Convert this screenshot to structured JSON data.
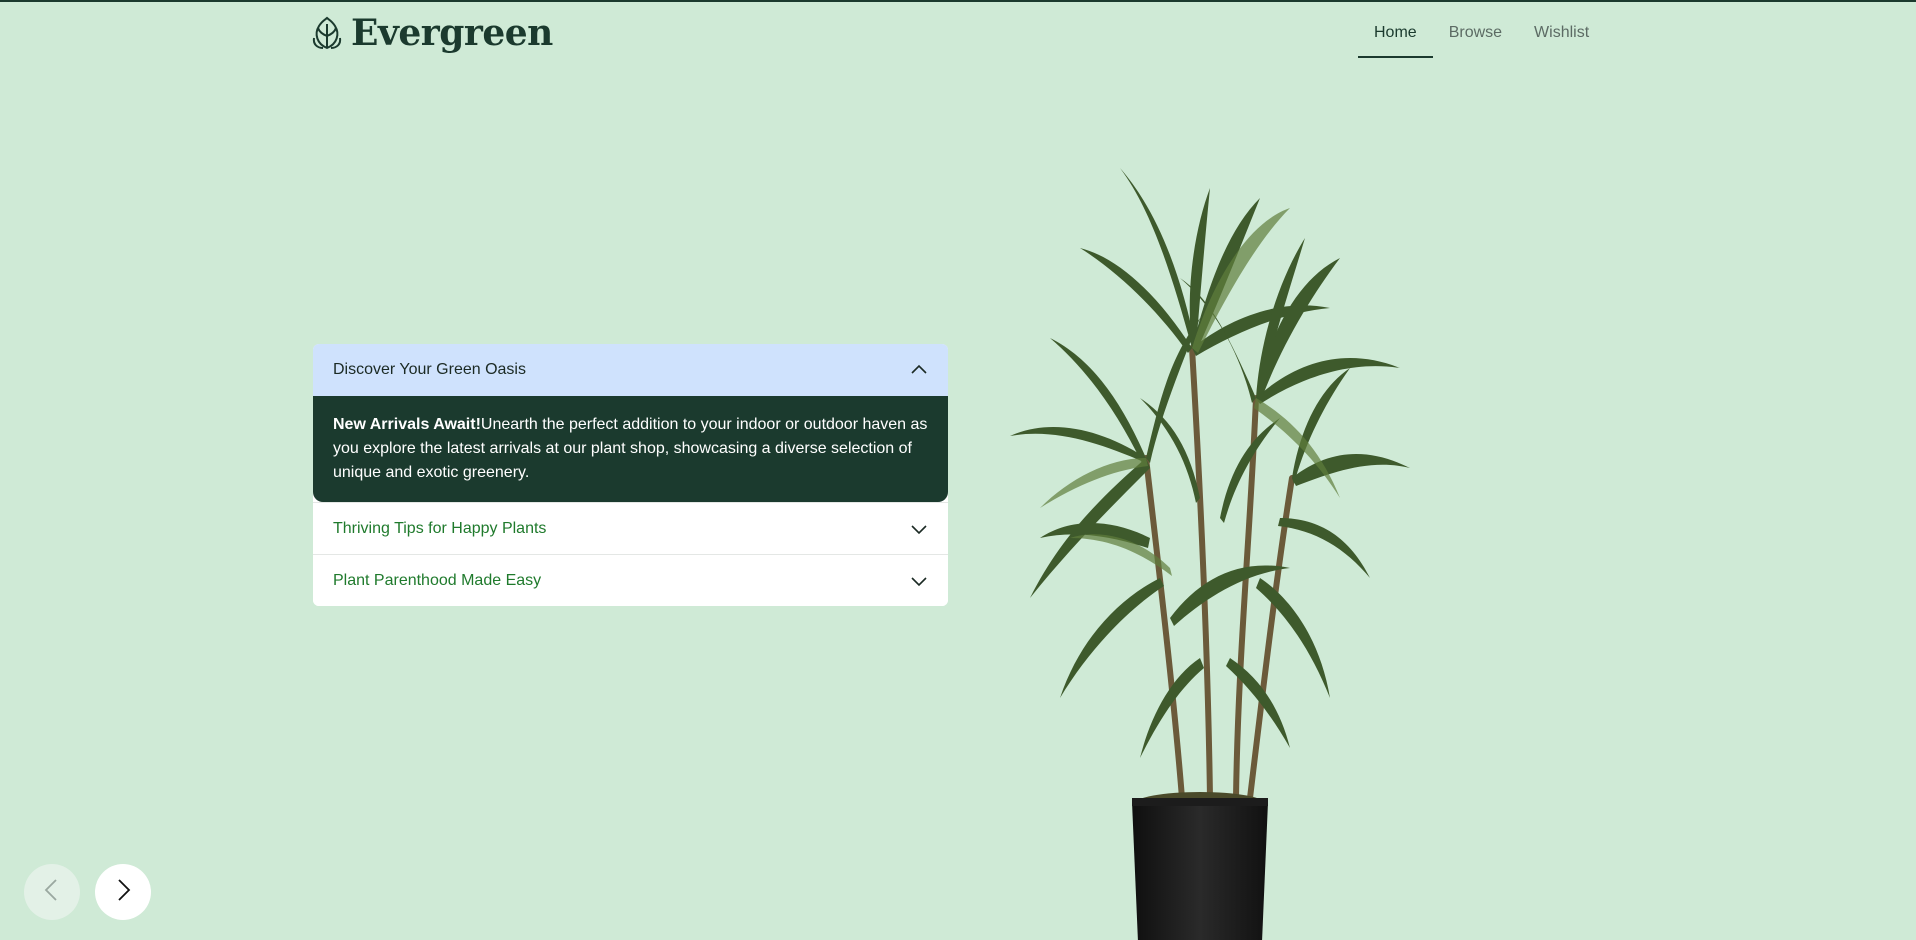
{
  "brand": {
    "name": "Evergreen",
    "logo_icon": "leaf-icon"
  },
  "nav": {
    "items": [
      {
        "label": "Home",
        "active": true
      },
      {
        "label": "Browse",
        "active": false
      },
      {
        "label": "Wishlist",
        "active": false
      }
    ]
  },
  "accordion": {
    "items": [
      {
        "title": "Discover Your Green Oasis",
        "open": true,
        "body_bold": "New Arrivals Await!",
        "body_text": "Unearth the perfect addition to your indoor or outdoor haven as you explore the latest arrivals at our plant shop, showcasing a diverse selection of unique and exotic greenery."
      },
      {
        "title": "Thriving Tips for Happy Plants",
        "open": false
      },
      {
        "title": "Plant Parenthood Made Easy",
        "open": false
      }
    ]
  },
  "carousel": {
    "prev_icon": "chevron-left-icon",
    "next_icon": "chevron-right-icon"
  },
  "colors": {
    "background": "#cfead6",
    "dark_green": "#1b3a2e",
    "accent_green": "#1f7a2c",
    "open_header": "#cfe2fd"
  }
}
